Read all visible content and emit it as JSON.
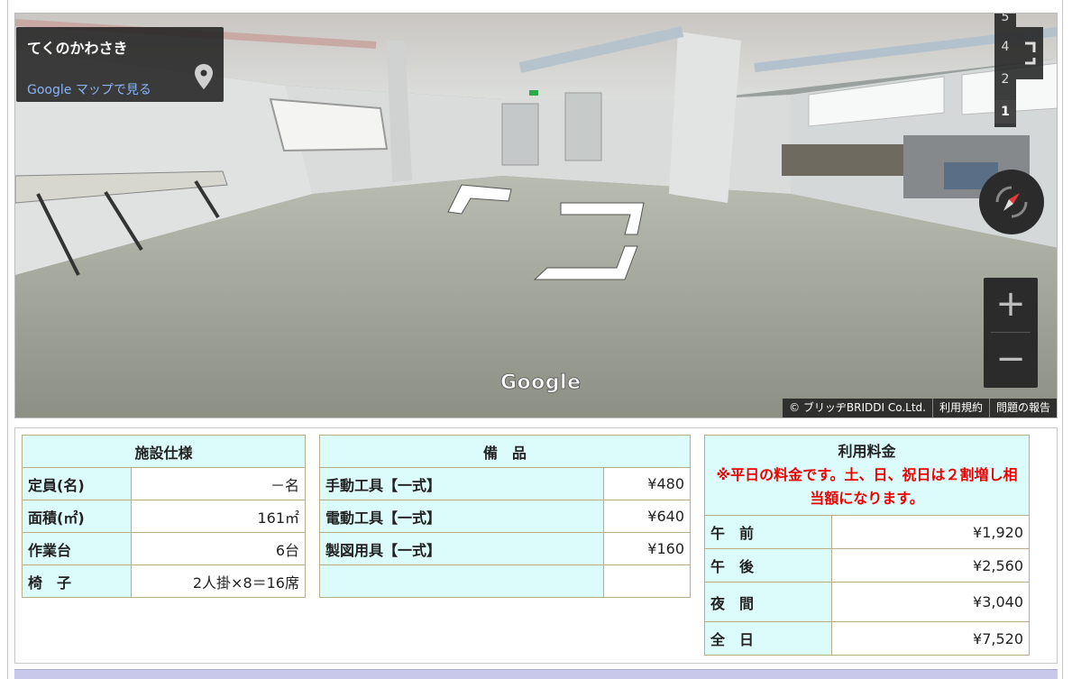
{
  "street_view": {
    "place_name": "てくのかわさき",
    "maps_link": "Google マップで見る",
    "logo": "Google",
    "floors": [
      "5",
      "4",
      "2",
      "1"
    ],
    "active_floor": "1",
    "zoom_in": "+",
    "zoom_out": "−",
    "copyright": "© ブリッヂBRIDDI Co.Ltd.",
    "terms": "利用規約",
    "report": "問題の報告",
    "icons": [
      "pin-icon",
      "fullscreen-icon",
      "compass-icon"
    ]
  },
  "specs": {
    "header": "施設仕様",
    "rows": [
      {
        "label": "定員(名)",
        "value": "－名"
      },
      {
        "label": "面積(㎡)",
        "value": "161㎡"
      },
      {
        "label": "作業台",
        "value": "6台"
      },
      {
        "label": "椅　子",
        "value": "2人掛×8＝16席"
      }
    ]
  },
  "equipment": {
    "header": "備　品",
    "rows": [
      {
        "label": "手動工具【一式】",
        "value": "¥480"
      },
      {
        "label": "電動工具【一式】",
        "value": "¥640"
      },
      {
        "label": "製図用具【一式】",
        "value": "¥160"
      },
      {
        "label": "",
        "value": ""
      }
    ]
  },
  "fees": {
    "header": "利用料金",
    "notice": "※平日の料金です。土、日、祝日は２割増し相当額になります。",
    "rows": [
      {
        "label": "午　前",
        "value": "¥1,920"
      },
      {
        "label": "午　後",
        "value": "¥2,560"
      },
      {
        "label": "夜　間",
        "value": "¥3,040"
      },
      {
        "label": "全　日",
        "value": "¥7,520"
      }
    ]
  },
  "colors": {
    "table_header_bg": "#dcfcfb",
    "table_border": "#b9ad89",
    "notice_red": "#ee0000",
    "bottom_bar": "#c8c8ea"
  }
}
